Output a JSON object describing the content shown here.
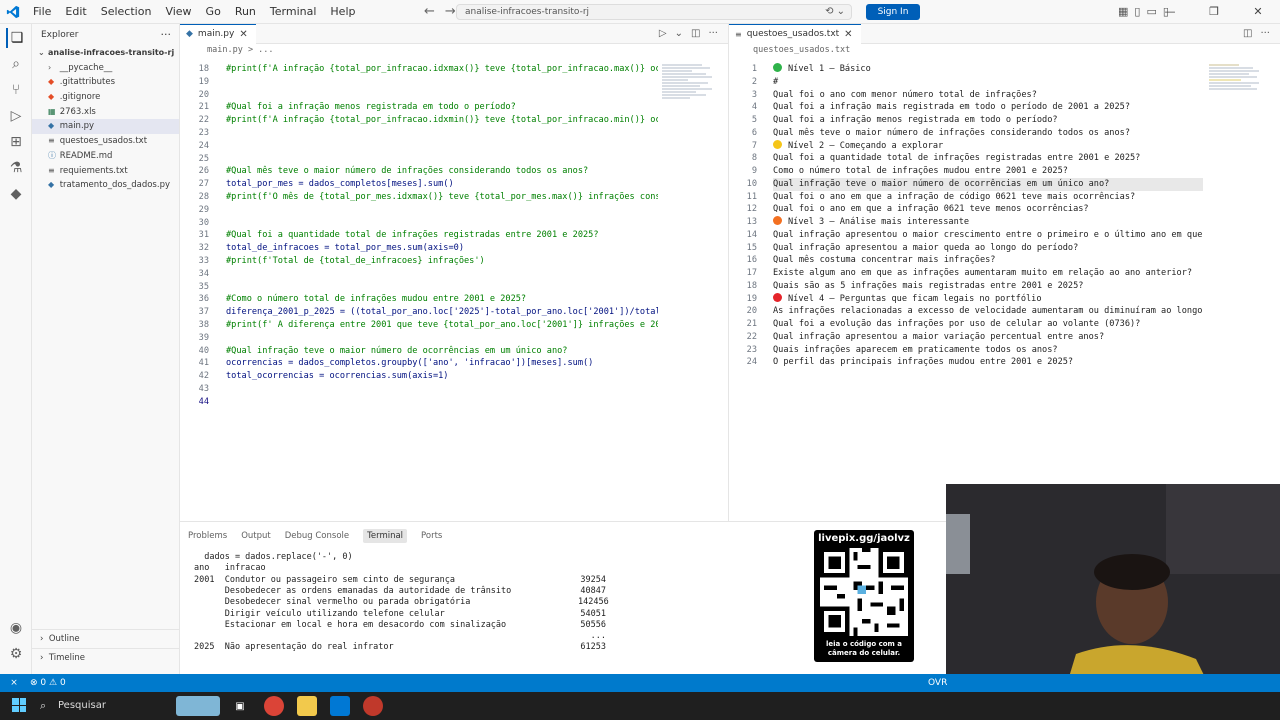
{
  "titlebar": {
    "menu": [
      "File",
      "Edit",
      "Selection",
      "View",
      "Go",
      "Run",
      "Terminal",
      "Help"
    ],
    "search": "analise-infracoes-transito-rj",
    "sign_in": "Sign In"
  },
  "sidebar": {
    "title": "Explorer",
    "project": "analise-infracoes-transito-rj",
    "items": [
      {
        "label": "__pycache__",
        "kind": "folder"
      },
      {
        "label": ".gitattributes",
        "kind": "git"
      },
      {
        "label": ".gitignore",
        "kind": "git"
      },
      {
        "label": "2763.xls",
        "kind": "xls"
      },
      {
        "label": "main.py",
        "kind": "py"
      },
      {
        "label": "questoes_usados.txt",
        "kind": "txt"
      },
      {
        "label": "README.md",
        "kind": "md"
      },
      {
        "label": "requiements.txt",
        "kind": "txt"
      },
      {
        "label": "tratamento_dos_dados.py",
        "kind": "py"
      }
    ],
    "outline": "Outline",
    "timeline": "Timeline"
  },
  "editor_left": {
    "tab": "main.py",
    "breadcrumb": "main.py > ...",
    "lines": [
      {
        "n": "18",
        "text": "#print(f'A infração {total_por_infracao.idxmax()} teve {total_por_infracao.max()} oc",
        "kind": "com"
      },
      {
        "n": "19",
        "text": "",
        "kind": "def"
      },
      {
        "n": "20",
        "text": "",
        "kind": "def"
      },
      {
        "n": "21",
        "text": "#Qual foi a infração menos registrada em todo o período?",
        "kind": "com"
      },
      {
        "n": "22",
        "text": "#print(f'A infração {total_por_infracao.idxmin()} teve {total_por_infracao.min()} oc",
        "kind": "com"
      },
      {
        "n": "23",
        "text": "",
        "kind": "def"
      },
      {
        "n": "24",
        "text": "",
        "kind": "def"
      },
      {
        "n": "25",
        "text": "",
        "kind": "def"
      },
      {
        "n": "26",
        "text": "#Qual mês teve o maior número de infrações considerando todos os anos?",
        "kind": "com"
      },
      {
        "n": "27",
        "text": "total_por_mes = dados_completos[meses].sum()",
        "kind": "def"
      },
      {
        "n": "28",
        "text": "#print(f'O mês de {total_por_mes.idxmax()} teve {total_por_mes.max()} infrações cons",
        "kind": "com"
      },
      {
        "n": "29",
        "text": "",
        "kind": "def"
      },
      {
        "n": "30",
        "text": "",
        "kind": "def"
      },
      {
        "n": "31",
        "text": "#Qual foi a quantidade total de infrações registradas entre 2001 e 2025?",
        "kind": "com"
      },
      {
        "n": "32",
        "text": "total_de_infracoes = total_por_mes.sum(axis=0)",
        "kind": "def"
      },
      {
        "n": "33",
        "text": "#print(f'Total de {total_de_infracoes} infrações')",
        "kind": "com"
      },
      {
        "n": "34",
        "text": "",
        "kind": "def"
      },
      {
        "n": "35",
        "text": "",
        "kind": "def"
      },
      {
        "n": "36",
        "text": "#Como o número total de infrações mudou entre 2001 e 2025?",
        "kind": "com"
      },
      {
        "n": "37",
        "text": "diferença_2001_p_2025 = ((total_por_ano.loc['2025']-total_por_ano.loc['2001'])/total",
        "kind": "def"
      },
      {
        "n": "38",
        "text": "#print(f' A diferença entre 2001 que teve {total_por_ano.loc['2001']} infrações e 20",
        "kind": "com"
      },
      {
        "n": "39",
        "text": "",
        "kind": "def"
      },
      {
        "n": "40",
        "text": "#Qual infração teve o maior número de ocorrências em um único ano?",
        "kind": "com"
      },
      {
        "n": "41",
        "text": "ocorrencias = dados_completos.groupby(['ano', 'infracao'])[meses].sum()",
        "kind": "def"
      },
      {
        "n": "42",
        "text": "total_ocorrencias = ocorrencias.sum(axis=1)",
        "kind": "def"
      },
      {
        "n": "43",
        "text": "",
        "kind": "def"
      },
      {
        "n": "44",
        "text": "",
        "kind": "def"
      }
    ]
  },
  "editor_right": {
    "tab": "questoes_usados.txt",
    "breadcrumb": "questoes_usados.txt",
    "lines": [
      {
        "n": "1",
        "text": "Nível 1 — Básico",
        "dot": "#2fb34a"
      },
      {
        "n": "2",
        "text": "#",
        "dot": ""
      },
      {
        "n": "3",
        "text": "Qual foi o ano com menor número total de infrações?",
        "dot": ""
      },
      {
        "n": "4",
        "text": "Qual foi a infração mais registrada em todo o período de 2001 a 2025?",
        "dot": ""
      },
      {
        "n": "5",
        "text": "Qual foi a infração menos registrada em todo o período?",
        "dot": ""
      },
      {
        "n": "6",
        "text": "Qual mês teve o maior número de infrações considerando todos os anos?",
        "dot": ""
      },
      {
        "n": "7",
        "text": "Nível 2 — Começando a explorar",
        "dot": "#f5c518"
      },
      {
        "n": "8",
        "text": "Qual foi a quantidade total de infrações registradas entre 2001 e 2025?",
        "dot": ""
      },
      {
        "n": "9",
        "text": "Como o número total de infrações mudou entre 2001 e 2025?",
        "dot": ""
      },
      {
        "n": "10",
        "text": "Qual infração teve o maior número de ocorrências em um único ano?",
        "dot": ""
      },
      {
        "n": "11",
        "text": "Qual foi o ano em que a infração de código 0621 teve mais ocorrências?",
        "dot": ""
      },
      {
        "n": "12",
        "text": "Qual foi o ano em que a infração 0621 teve menos ocorrências?",
        "dot": ""
      },
      {
        "n": "13",
        "text": "Nível 3 — Análise mais interessante",
        "dot": "#f37021"
      },
      {
        "n": "14",
        "text": "Qual infração apresentou o maior crescimento entre o primeiro e o último ano em que",
        "dot": ""
      },
      {
        "n": "15",
        "text": "Qual infração apresentou a maior queda ao longo do período?",
        "dot": ""
      },
      {
        "n": "16",
        "text": "Qual mês costuma concentrar mais infrações?",
        "dot": ""
      },
      {
        "n": "17",
        "text": "Existe algum ano em que as infrações aumentaram muito em relação ao ano anterior?",
        "dot": ""
      },
      {
        "n": "18",
        "text": "Quais são as 5 infrações mais registradas entre 2001 e 2025?",
        "dot": ""
      },
      {
        "n": "19",
        "text": "Nível 4 — Perguntas que ficam legais no portfólio",
        "dot": "#e5242a"
      },
      {
        "n": "20",
        "text": "As infrações relacionadas a excesso de velocidade aumentaram ou diminuíram ao longo",
        "dot": ""
      },
      {
        "n": "21",
        "text": "Qual foi a evolução das infrações por uso de celular ao volante (0736)?",
        "dot": ""
      },
      {
        "n": "22",
        "text": "Qual infração apresentou a maior variação percentual entre anos?",
        "dot": ""
      },
      {
        "n": "23",
        "text": "Quais infrações aparecem em praticamente todos os anos?",
        "dot": ""
      },
      {
        "n": "24",
        "text": "O perfil das principais infrações mudou entre 2001 e 2025?",
        "dot": ""
      }
    ]
  },
  "panel": {
    "tabs": [
      "Problems",
      "Output",
      "Debug Console",
      "Terminal",
      "Ports"
    ],
    "active": "Terminal",
    "terminal": [
      {
        "text": "  dados = dados.replace('-', 0)",
        "count": ""
      },
      {
        "text": "ano   infracao",
        "count": ""
      },
      {
        "text": "2001  Condutor ou passageiro sem cinto de segurança",
        "count": "39254"
      },
      {
        "text": "      Desobedecer as ordens emanadas da autoridade de trânsito",
        "count": "40847"
      },
      {
        "text": "      Desobedecer sinal vermelho ou parada obrigatória",
        "count": "142456"
      },
      {
        "text": "      Dirigir veículo utilizando telefone celular",
        "count": "54051"
      },
      {
        "text": "      Estacionar em local e hora em desacordo com sinalização",
        "count": "50556"
      },
      {
        "text": "",
        "count": "..."
      },
      {
        "text": "2025  Não apresentação do real infrator",
        "count": "61253"
      }
    ]
  },
  "overlay": {
    "qr_top": "livepix.gg/jaolvz",
    "qr_bottom": "leia o código com a câmera do celular."
  },
  "statusbar": {
    "problems": "0",
    "warnings": "0",
    "ovr": "OVR"
  },
  "taskbar": {
    "search": "Pesquisar"
  }
}
